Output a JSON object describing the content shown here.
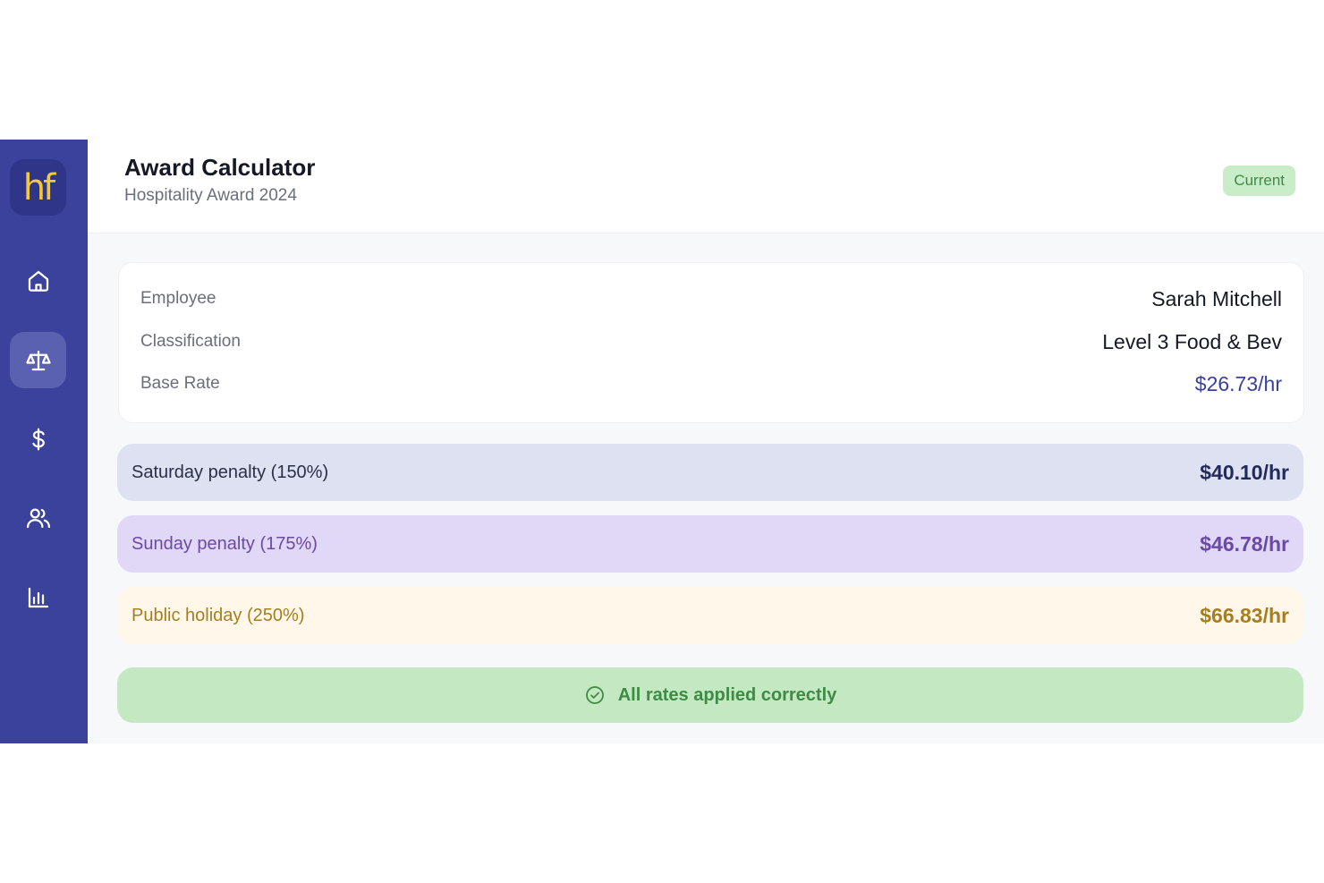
{
  "brand": {
    "logo_text": "hf",
    "accent": "#3b429b",
    "logo_color": "#f5c835"
  },
  "sidebar": {
    "items": [
      {
        "icon": "home-icon",
        "active": false
      },
      {
        "icon": "scale-icon",
        "active": true
      },
      {
        "icon": "dollar-icon",
        "active": false
      },
      {
        "icon": "users-icon",
        "active": false
      },
      {
        "icon": "bar-chart-icon",
        "active": false
      }
    ]
  },
  "header": {
    "title": "Award Calculator",
    "subtitle": "Hospitality Award 2024",
    "badge": "Current"
  },
  "employee": {
    "rows": [
      {
        "label": "Employee",
        "value": "Sarah Mitchell"
      },
      {
        "label": "Classification",
        "value": "Level 3 Food & Bev"
      },
      {
        "label": "Base Rate",
        "value": "$26.73/hr"
      }
    ]
  },
  "penalties": [
    {
      "label": "Saturday penalty (150%)",
      "value": "$40.10/hr",
      "color": "#dde1f1"
    },
    {
      "label": "Sunday penalty (175%)",
      "value": "$46.78/hr",
      "color": "#e1d7f7"
    },
    {
      "label": "Public holiday (250%)",
      "value": "$66.83/hr",
      "color": "#fff8ea"
    }
  ],
  "status": {
    "icon": "check-circle-icon",
    "text": "All rates applied correctly",
    "color": "#3e8b46"
  }
}
